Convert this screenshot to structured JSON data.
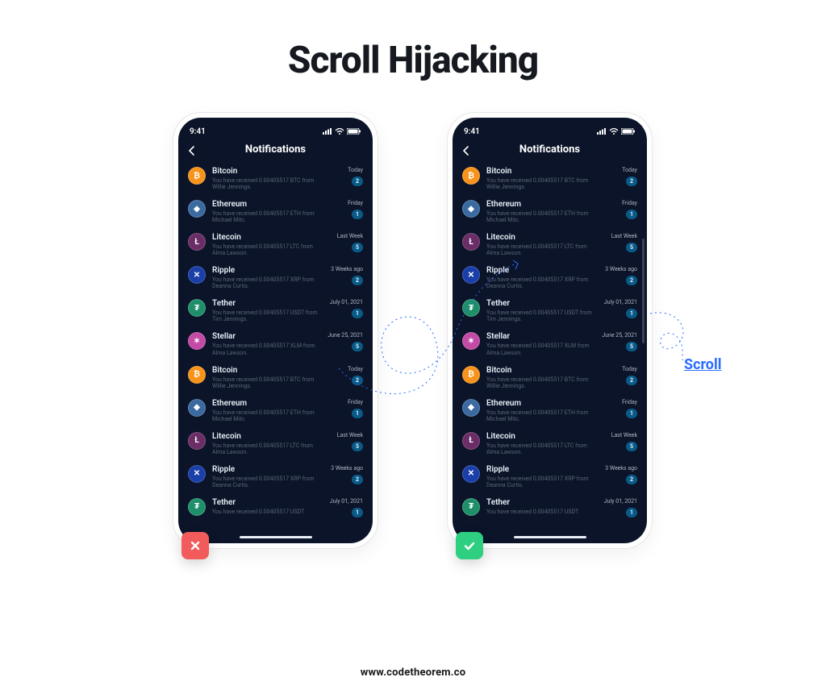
{
  "title": "Scroll Hijacking",
  "footer": "www.codetheorem.co",
  "status_time": "9:41",
  "nav_title": "Notifications",
  "scroll_label": "Scroll",
  "coins": {
    "btc": {
      "bg": "#f7931a",
      "glyph": "₿"
    },
    "eth": {
      "bg": "#3b6aa0",
      "glyph": "◆"
    },
    "ltc": {
      "bg": "#6b2d66",
      "glyph": "Ł"
    },
    "xrp": {
      "bg": "#1a3fa8",
      "glyph": "✕"
    },
    "usdt": {
      "bg": "#1f8f6a",
      "glyph": "₮"
    },
    "xlm": {
      "bg": "#c34aa5",
      "glyph": "✶"
    }
  },
  "rows": [
    {
      "coin": "btc",
      "name": "Bitcoin",
      "desc": "You have received  0.00405517 BTC from Willie Jennings.",
      "time": "Today",
      "count": "2"
    },
    {
      "coin": "eth",
      "name": "Ethereum",
      "desc": "You have received  0.00405517 ETH from Michael Mitc.",
      "time": "Friday",
      "count": "1"
    },
    {
      "coin": "ltc",
      "name": "Litecoin",
      "desc": "You have received  0.00405517 LTC from Alma Lawson.",
      "time": "Last Week",
      "count": "5"
    },
    {
      "coin": "xrp",
      "name": "Ripple",
      "desc": "You have received  0.00405517 XRP from Deanna Curtis.",
      "time": "3 Weeks ago",
      "count": "2"
    },
    {
      "coin": "usdt",
      "name": "Tether",
      "desc": "You have received  0.00405517 USDT from Tim Jennings.",
      "time": "July 01, 2021",
      "count": "1"
    },
    {
      "coin": "xlm",
      "name": "Stellar",
      "desc": "You have received  0.00405517 XLM from Alma Lawson.",
      "time": "June 25, 2021",
      "count": "5"
    },
    {
      "coin": "btc",
      "name": "Bitcoin",
      "desc": "You have received  0.00405517 BTC from Willie Jennings.",
      "time": "Today",
      "count": "2"
    },
    {
      "coin": "eth",
      "name": "Ethereum",
      "desc": "You have received  0.00405517 ETH from Michael Mitc.",
      "time": "Friday",
      "count": "1"
    },
    {
      "coin": "ltc",
      "name": "Litecoin",
      "desc": "You have received  0.00405517 LTC from Alma Lawson.",
      "time": "Last Week",
      "count": "5"
    },
    {
      "coin": "xrp",
      "name": "Ripple",
      "desc": "You have received  0.00405517 XRP from Deanna Curtis.",
      "time": "3 Weeks ago",
      "count": "2"
    },
    {
      "coin": "usdt",
      "name": "Tether",
      "desc": "You have received  0.00405517 USDT",
      "time": "July 01, 2021",
      "count": "1"
    }
  ]
}
